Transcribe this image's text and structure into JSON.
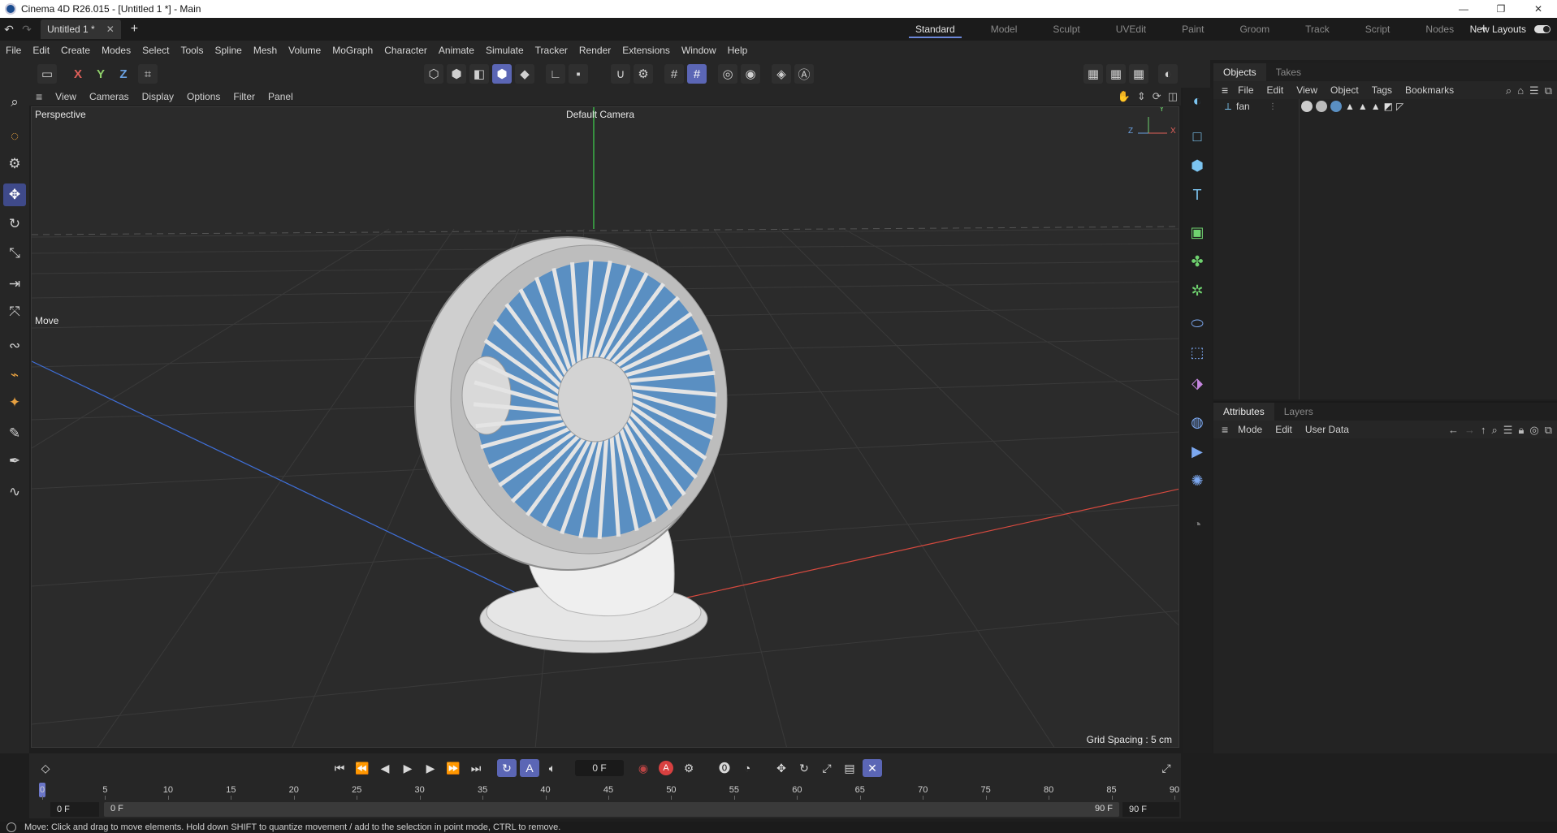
{
  "window": {
    "title": "Cinema 4D R26.015 - [Untitled 1 *] - Main",
    "minimize": "—",
    "restore": "❐",
    "close": "✕"
  },
  "tabs": {
    "doc_tab": "Untitled 1 *",
    "close": "✕",
    "new": "+",
    "layouts": [
      "Standard",
      "Model",
      "Sculpt",
      "UVEdit",
      "Paint",
      "Groom",
      "Track",
      "Script",
      "Nodes"
    ],
    "add_layout": "+",
    "new_layouts": "New Layouts"
  },
  "menu": [
    "File",
    "Edit",
    "Create",
    "Modes",
    "Select",
    "Tools",
    "Spline",
    "Mesh",
    "Volume",
    "MoGraph",
    "Character",
    "Animate",
    "Simulate",
    "Tracker",
    "Render",
    "Extensions",
    "Window",
    "Help"
  ],
  "toolbar": {
    "axis_x": "X",
    "axis_y": "Y",
    "axis_z": "Z"
  },
  "viewport": {
    "menu": [
      "View",
      "Cameras",
      "Display",
      "Options",
      "Filter",
      "Panel"
    ],
    "projection": "Perspective",
    "camera": "Default Camera",
    "tool_label": "Move",
    "grid_spacing": "Grid Spacing : 5 cm"
  },
  "objects_panel": {
    "tabs": [
      "Objects",
      "Takes"
    ],
    "menu": [
      "File",
      "Edit",
      "View",
      "Object",
      "Tags",
      "Bookmarks"
    ],
    "object_name": "fan"
  },
  "attributes_panel": {
    "tabs": [
      "Attributes",
      "Layers"
    ],
    "menu": [
      "Mode",
      "Edit",
      "User Data"
    ]
  },
  "timeline": {
    "current_frame": "0 F",
    "record_label": "A",
    "ruler_ticks": [
      "0",
      "5",
      "10",
      "15",
      "20",
      "25",
      "30",
      "35",
      "40",
      "45",
      "50",
      "55",
      "60",
      "65",
      "70",
      "75",
      "80",
      "85",
      "90"
    ],
    "range_start": "0 F",
    "range_start_inner": "0 F",
    "range_end_inner": "90 F",
    "range_end": "90 F"
  },
  "status": {
    "message": "Move: Click and drag to move elements. Hold down SHIFT to quantize movement / add to the selection in point mode, CTRL to remove."
  },
  "colors": {
    "accent": "#5b66b5",
    "x_axis": "#e0605a",
    "y_axis": "#8fcf6a",
    "z_axis": "#6aa0e0"
  }
}
